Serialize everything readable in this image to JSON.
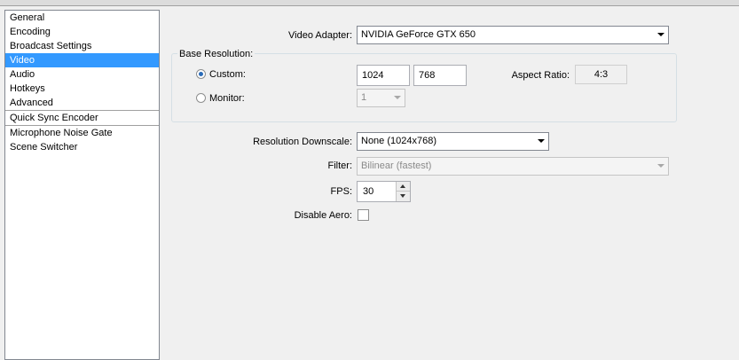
{
  "sidebar": {
    "groups": [
      [
        "General",
        "Encoding",
        "Broadcast Settings",
        "Video",
        "Audio",
        "Hotkeys",
        "Advanced"
      ],
      [
        "Quick Sync Encoder"
      ],
      [
        "Microphone Noise Gate",
        "Scene Switcher"
      ]
    ],
    "selected": "Video"
  },
  "video_adapter": {
    "label": "Video Adapter:",
    "value": "NVIDIA GeForce GTX 650"
  },
  "base_resolution": {
    "title": "Base Resolution:",
    "custom_label": "Custom:",
    "custom_selected": true,
    "width": "1024",
    "height": "768",
    "aspect_label": "Aspect Ratio:",
    "aspect_value": "4:3",
    "monitor_label": "Monitor:",
    "monitor_value": "1"
  },
  "downscale": {
    "label": "Resolution Downscale:",
    "value": "None  (1024x768)"
  },
  "filter": {
    "label": "Filter:",
    "value": "Bilinear (fastest)",
    "disabled": true
  },
  "fps": {
    "label": "FPS:",
    "value": "30"
  },
  "disable_aero": {
    "label": "Disable Aero:",
    "checked": false
  },
  "colors": {
    "selection": "#3399ff",
    "radio_dot": "#2a6bb8"
  }
}
